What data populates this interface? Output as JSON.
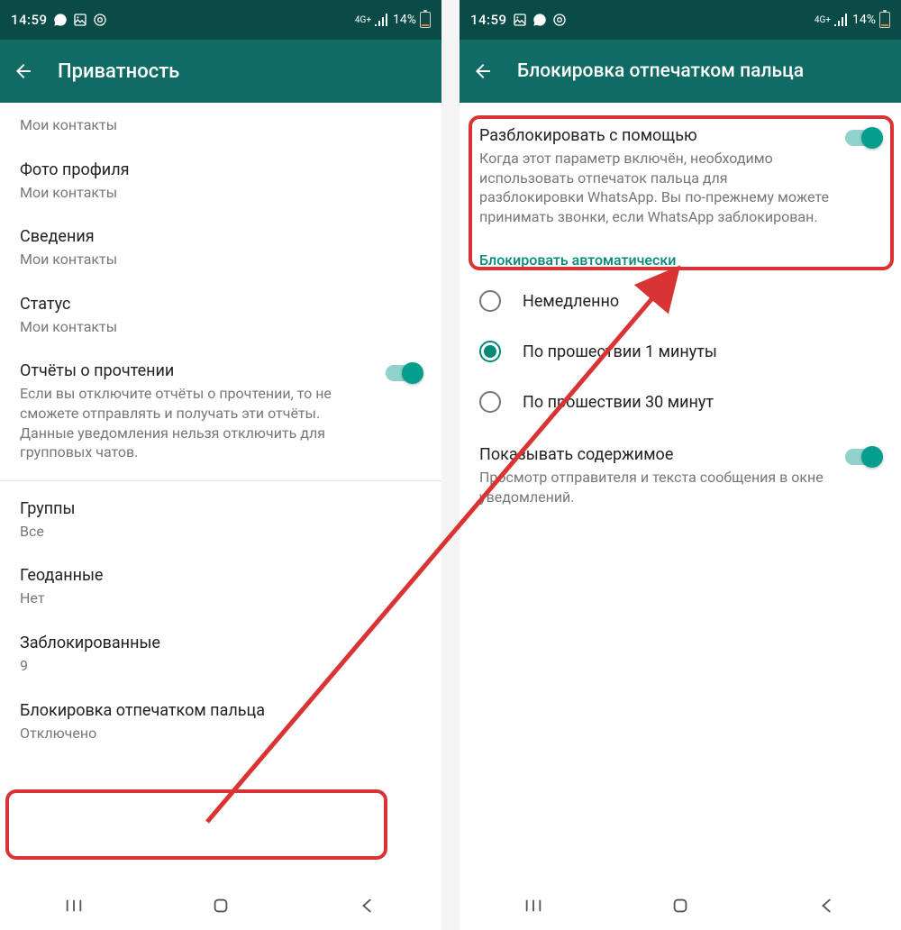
{
  "status": {
    "time": "14:59",
    "network_badge": "4G+",
    "battery_pct": "14%"
  },
  "left_screen": {
    "title": "Приватность",
    "items": [
      {
        "label": "Мои контакты"
      },
      {
        "label": "Фото профиля",
        "sub": "Мои контакты"
      },
      {
        "label": "Сведения",
        "sub": "Мои контакты"
      },
      {
        "label": "Статус",
        "sub": "Мои контакты"
      },
      {
        "label": "Отчёты о прочтении",
        "sub": "Если вы отключите отчёты о прочтении, то не сможете отправлять и получать эти отчёты. Данные уведомления нельзя отключить для групповых чатов."
      },
      {
        "label": "Группы",
        "sub": "Все"
      },
      {
        "label": "Геоданные",
        "sub": "Нет"
      },
      {
        "label": "Заблокированные",
        "sub": "9"
      },
      {
        "label": "Блокировка отпечатком пальца",
        "sub": "Отключено"
      }
    ]
  },
  "right_screen": {
    "title": "Блокировка отпечатком пальца",
    "unlock": {
      "label": "Разблокировать с помощью",
      "sub": "Когда этот параметр включён, необходимо использовать отпечаток пальца для разблокировки WhatsApp. Вы по-прежнему можете принимать звонки, если WhatsApp заблокирован."
    },
    "auto_section": "Блокировать автоматически",
    "radios": [
      {
        "label": "Немедленно",
        "checked": false
      },
      {
        "label": "По прошествии 1 минуты",
        "checked": true
      },
      {
        "label": "По прошествии 30 минут",
        "checked": false
      }
    ],
    "show_content": {
      "label": "Показывать содержимое",
      "sub": "Просмотр отправителя и текста сообщения в окне уведомлений."
    }
  }
}
